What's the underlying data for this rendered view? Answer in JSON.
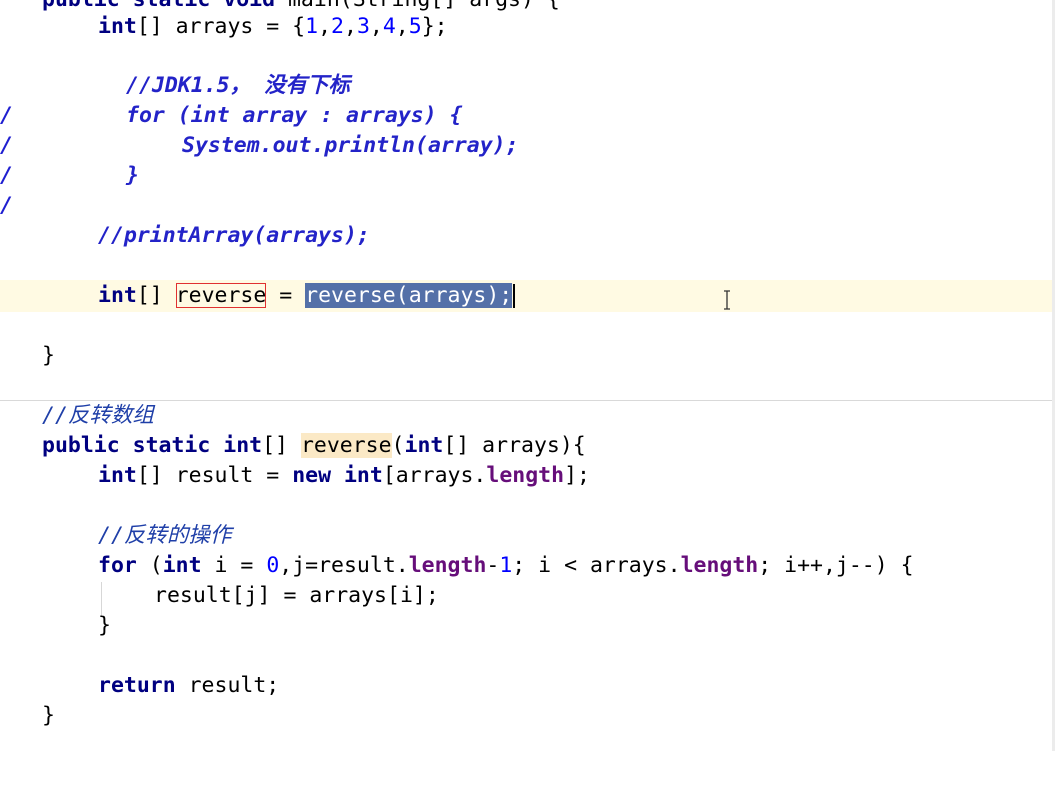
{
  "editor": {
    "gutter_marker": "/",
    "lines": {
      "l0": {
        "kw1": "public",
        "kw2": "static",
        "kw3": "void",
        "rest": "main(String[] args) {"
      },
      "l1": {
        "kw": "int",
        "mid": "[] arrays = {",
        "n1": "1",
        "n2": "2",
        "n3": "3",
        "n4": "4",
        "n5": "5",
        "end": "};",
        "comma": ","
      },
      "l2": {
        "text": "//JDK1.5， 没有下标"
      },
      "l3": {
        "text": "for (int array : arrays) {"
      },
      "l4": {
        "text": "System.out.println(array);"
      },
      "l5": {
        "text": "}"
      },
      "l6": {
        "text": "//printArray(arrays);"
      },
      "l7": {
        "kw": "int",
        "brackets": "[] ",
        "var": "reverse",
        "eq": " = ",
        "sel": "reverse(arrays);"
      },
      "l8": {
        "text": "}"
      },
      "l9": {
        "text": "//反转数组"
      },
      "l10": {
        "kw1": "public",
        "kw2": "static",
        "kw3": "int",
        "brackets": "[] ",
        "name": "reverse",
        "open": "(",
        "kw4": "int",
        "rest": "[] arrays){"
      },
      "l11": {
        "kw1": "int",
        "mid": "[] result = ",
        "kw2": "new",
        "kw3": "int",
        "open": "[arrays.",
        "field": "length",
        "end": "];"
      },
      "l12": {
        "text": "//反转的操作"
      },
      "l13": {
        "kw1": "for",
        "p1": " (",
        "kw2": "int",
        "p2": " i = ",
        "n0": "0",
        "p3": ",j=result.",
        "f1": "length",
        "p4": "-",
        "n1": "1",
        "p5": "; i < arrays.",
        "f2": "length",
        "p6": "; i++,j--) {"
      },
      "l14": {
        "text": "result[j] = arrays[i];"
      },
      "l15": {
        "text": "}"
      },
      "l16": {
        "kw": "return",
        "rest": " result;"
      },
      "l17": {
        "text": "}"
      }
    }
  }
}
